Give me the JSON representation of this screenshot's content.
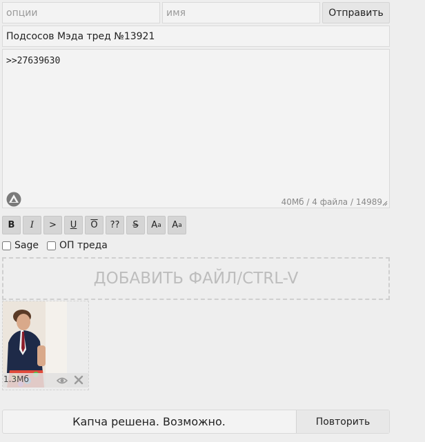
{
  "form": {
    "options_placeholder": "опции",
    "name_placeholder": "имя",
    "submit_label": "Отправить",
    "subject_value": "Подсосов Мэда тред №13921",
    "comment_value": ">>27639630",
    "counter": "40Мб / 4 файла / 14989"
  },
  "toolbar": {
    "bold": "B",
    "italic": "I",
    "quote": ">",
    "underline": "U",
    "overline": "O",
    "spoiler": "??",
    "strike": "S",
    "sup_base": "A",
    "sup_mark": "a",
    "sub_base": "A",
    "sub_mark": "a"
  },
  "checks": {
    "sage_label": "Sage",
    "op_label": "ОП треда"
  },
  "dropzone": {
    "label": "ДОБАВИТЬ ФАЙЛ/CTRL-V"
  },
  "attachment": {
    "size": "1.3Мб",
    "icons": [
      "eye-icon",
      "close-icon"
    ]
  },
  "captcha": {
    "status": "Капча решена. Возможно.",
    "retry_label": "Повторить"
  },
  "colors": {
    "background": "#eeeeee",
    "field": "#f3f3f3",
    "border": "#d9d9d9",
    "toolbar_button": "#d5d5d5"
  }
}
